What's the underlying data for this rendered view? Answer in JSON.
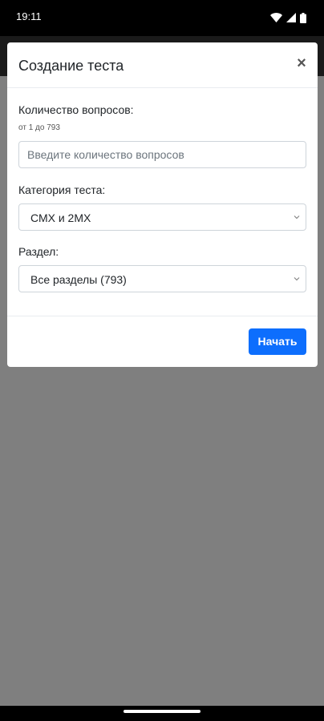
{
  "status_bar": {
    "time": "19:11",
    "icons": [
      "wifi-icon",
      "signal-icon",
      "battery-icon"
    ]
  },
  "modal": {
    "title": "Создание теста",
    "close_symbol": "×",
    "questions": {
      "label": "Количество вопросов:",
      "hint": "от 1 до 793",
      "value": "",
      "placeholder": "Введите количество вопросов"
    },
    "category": {
      "label": "Категория теста:",
      "selected": "СМХ и 2МХ"
    },
    "section": {
      "label": "Раздел:",
      "selected": "Все разделы (793)"
    },
    "start_label": "Начать"
  },
  "colors": {
    "primary": "#0d6efd",
    "backdrop": "#7f7f7f"
  }
}
